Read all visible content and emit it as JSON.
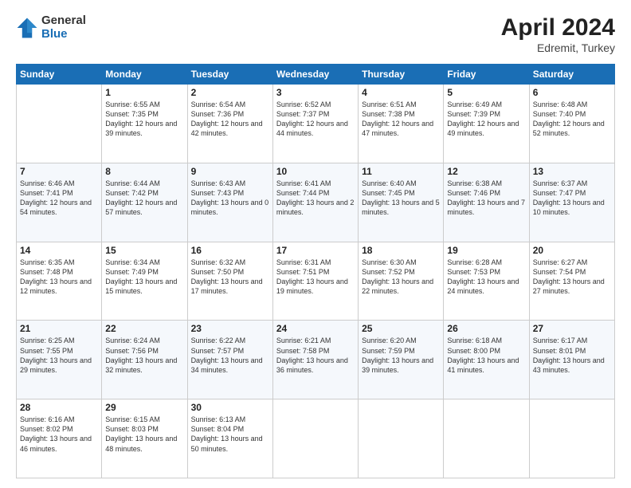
{
  "header": {
    "logo_general": "General",
    "logo_blue": "Blue",
    "title": "April 2024",
    "location": "Edremit, Turkey"
  },
  "days_of_week": [
    "Sunday",
    "Monday",
    "Tuesday",
    "Wednesday",
    "Thursday",
    "Friday",
    "Saturday"
  ],
  "weeks": [
    [
      {
        "day": "",
        "sunrise": "",
        "sunset": "",
        "daylight": ""
      },
      {
        "day": "1",
        "sunrise": "Sunrise: 6:55 AM",
        "sunset": "Sunset: 7:35 PM",
        "daylight": "Daylight: 12 hours and 39 minutes."
      },
      {
        "day": "2",
        "sunrise": "Sunrise: 6:54 AM",
        "sunset": "Sunset: 7:36 PM",
        "daylight": "Daylight: 12 hours and 42 minutes."
      },
      {
        "day": "3",
        "sunrise": "Sunrise: 6:52 AM",
        "sunset": "Sunset: 7:37 PM",
        "daylight": "Daylight: 12 hours and 44 minutes."
      },
      {
        "day": "4",
        "sunrise": "Sunrise: 6:51 AM",
        "sunset": "Sunset: 7:38 PM",
        "daylight": "Daylight: 12 hours and 47 minutes."
      },
      {
        "day": "5",
        "sunrise": "Sunrise: 6:49 AM",
        "sunset": "Sunset: 7:39 PM",
        "daylight": "Daylight: 12 hours and 49 minutes."
      },
      {
        "day": "6",
        "sunrise": "Sunrise: 6:48 AM",
        "sunset": "Sunset: 7:40 PM",
        "daylight": "Daylight: 12 hours and 52 minutes."
      }
    ],
    [
      {
        "day": "7",
        "sunrise": "Sunrise: 6:46 AM",
        "sunset": "Sunset: 7:41 PM",
        "daylight": "Daylight: 12 hours and 54 minutes."
      },
      {
        "day": "8",
        "sunrise": "Sunrise: 6:44 AM",
        "sunset": "Sunset: 7:42 PM",
        "daylight": "Daylight: 12 hours and 57 minutes."
      },
      {
        "day": "9",
        "sunrise": "Sunrise: 6:43 AM",
        "sunset": "Sunset: 7:43 PM",
        "daylight": "Daylight: 13 hours and 0 minutes."
      },
      {
        "day": "10",
        "sunrise": "Sunrise: 6:41 AM",
        "sunset": "Sunset: 7:44 PM",
        "daylight": "Daylight: 13 hours and 2 minutes."
      },
      {
        "day": "11",
        "sunrise": "Sunrise: 6:40 AM",
        "sunset": "Sunset: 7:45 PM",
        "daylight": "Daylight: 13 hours and 5 minutes."
      },
      {
        "day": "12",
        "sunrise": "Sunrise: 6:38 AM",
        "sunset": "Sunset: 7:46 PM",
        "daylight": "Daylight: 13 hours and 7 minutes."
      },
      {
        "day": "13",
        "sunrise": "Sunrise: 6:37 AM",
        "sunset": "Sunset: 7:47 PM",
        "daylight": "Daylight: 13 hours and 10 minutes."
      }
    ],
    [
      {
        "day": "14",
        "sunrise": "Sunrise: 6:35 AM",
        "sunset": "Sunset: 7:48 PM",
        "daylight": "Daylight: 13 hours and 12 minutes."
      },
      {
        "day": "15",
        "sunrise": "Sunrise: 6:34 AM",
        "sunset": "Sunset: 7:49 PM",
        "daylight": "Daylight: 13 hours and 15 minutes."
      },
      {
        "day": "16",
        "sunrise": "Sunrise: 6:32 AM",
        "sunset": "Sunset: 7:50 PM",
        "daylight": "Daylight: 13 hours and 17 minutes."
      },
      {
        "day": "17",
        "sunrise": "Sunrise: 6:31 AM",
        "sunset": "Sunset: 7:51 PM",
        "daylight": "Daylight: 13 hours and 19 minutes."
      },
      {
        "day": "18",
        "sunrise": "Sunrise: 6:30 AM",
        "sunset": "Sunset: 7:52 PM",
        "daylight": "Daylight: 13 hours and 22 minutes."
      },
      {
        "day": "19",
        "sunrise": "Sunrise: 6:28 AM",
        "sunset": "Sunset: 7:53 PM",
        "daylight": "Daylight: 13 hours and 24 minutes."
      },
      {
        "day": "20",
        "sunrise": "Sunrise: 6:27 AM",
        "sunset": "Sunset: 7:54 PM",
        "daylight": "Daylight: 13 hours and 27 minutes."
      }
    ],
    [
      {
        "day": "21",
        "sunrise": "Sunrise: 6:25 AM",
        "sunset": "Sunset: 7:55 PM",
        "daylight": "Daylight: 13 hours and 29 minutes."
      },
      {
        "day": "22",
        "sunrise": "Sunrise: 6:24 AM",
        "sunset": "Sunset: 7:56 PM",
        "daylight": "Daylight: 13 hours and 32 minutes."
      },
      {
        "day": "23",
        "sunrise": "Sunrise: 6:22 AM",
        "sunset": "Sunset: 7:57 PM",
        "daylight": "Daylight: 13 hours and 34 minutes."
      },
      {
        "day": "24",
        "sunrise": "Sunrise: 6:21 AM",
        "sunset": "Sunset: 7:58 PM",
        "daylight": "Daylight: 13 hours and 36 minutes."
      },
      {
        "day": "25",
        "sunrise": "Sunrise: 6:20 AM",
        "sunset": "Sunset: 7:59 PM",
        "daylight": "Daylight: 13 hours and 39 minutes."
      },
      {
        "day": "26",
        "sunrise": "Sunrise: 6:18 AM",
        "sunset": "Sunset: 8:00 PM",
        "daylight": "Daylight: 13 hours and 41 minutes."
      },
      {
        "day": "27",
        "sunrise": "Sunrise: 6:17 AM",
        "sunset": "Sunset: 8:01 PM",
        "daylight": "Daylight: 13 hours and 43 minutes."
      }
    ],
    [
      {
        "day": "28",
        "sunrise": "Sunrise: 6:16 AM",
        "sunset": "Sunset: 8:02 PM",
        "daylight": "Daylight: 13 hours and 46 minutes."
      },
      {
        "day": "29",
        "sunrise": "Sunrise: 6:15 AM",
        "sunset": "Sunset: 8:03 PM",
        "daylight": "Daylight: 13 hours and 48 minutes."
      },
      {
        "day": "30",
        "sunrise": "Sunrise: 6:13 AM",
        "sunset": "Sunset: 8:04 PM",
        "daylight": "Daylight: 13 hours and 50 minutes."
      },
      {
        "day": "",
        "sunrise": "",
        "sunset": "",
        "daylight": ""
      },
      {
        "day": "",
        "sunrise": "",
        "sunset": "",
        "daylight": ""
      },
      {
        "day": "",
        "sunrise": "",
        "sunset": "",
        "daylight": ""
      },
      {
        "day": "",
        "sunrise": "",
        "sunset": "",
        "daylight": ""
      }
    ]
  ]
}
